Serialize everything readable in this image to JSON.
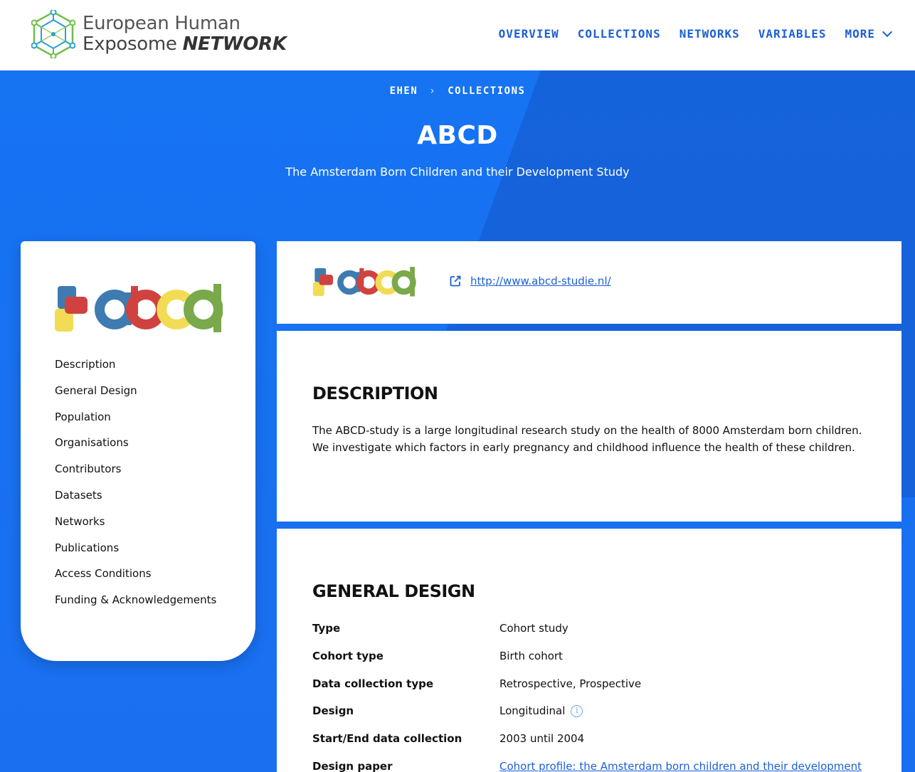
{
  "header": {
    "brand_line1": "European Human",
    "brand_line2_prefix": "Exposome",
    "brand_line2_emphasis": "NETWORK",
    "nav": [
      {
        "label": "OVERVIEW"
      },
      {
        "label": "COLLECTIONS"
      },
      {
        "label": "NETWORKS"
      },
      {
        "label": "VARIABLES"
      },
      {
        "label": "MORE",
        "icon": "chevron-down-icon"
      }
    ]
  },
  "breadcrumb": {
    "items": [
      "EHEN",
      "COLLECTIONS"
    ],
    "separator": "›"
  },
  "page": {
    "title": "ABCD",
    "subtitle": "The Amsterdam Born Children and their Development Study"
  },
  "sidebar": {
    "logo_alt": "abcd",
    "items": [
      {
        "label": "Description"
      },
      {
        "label": "General Design"
      },
      {
        "label": "Population"
      },
      {
        "label": "Organisations"
      },
      {
        "label": "Contributors"
      },
      {
        "label": "Datasets"
      },
      {
        "label": "Networks"
      },
      {
        "label": "Publications"
      },
      {
        "label": "Access Conditions"
      },
      {
        "label": "Funding & Acknowledgements"
      }
    ]
  },
  "link_card": {
    "url": "http://www.abcd-studie.nl/",
    "icon": "external-link-icon"
  },
  "description": {
    "title": "Description",
    "text": "The ABCD-study is a large longitudinal research study on the health of 8000 Amsterdam born children. We investigate which factors in early pregnancy and childhood influence the health of these children."
  },
  "general_design": {
    "title": "General Design",
    "rows": [
      {
        "key": "Type",
        "value": "Cohort study"
      },
      {
        "key": "Cohort type",
        "value": "Birth cohort"
      },
      {
        "key": "Data collection type",
        "value": "Retrospective, Prospective"
      },
      {
        "key": "Design",
        "value": "Longitudinal",
        "icon": "info-icon"
      },
      {
        "key": "Start/End data collection",
        "value": "2003 until 2004"
      },
      {
        "key": "Design paper",
        "value": "Cohort profile: the Amsterdam born children and their development"
      }
    ]
  },
  "colors": {
    "primary_blue": "#1a73f0",
    "link_blue": "#1b5fd6",
    "logo_blue": "#3e7bb0",
    "logo_red": "#d0423f",
    "logo_yellow": "#f2dc55",
    "logo_green": "#79a94b"
  }
}
